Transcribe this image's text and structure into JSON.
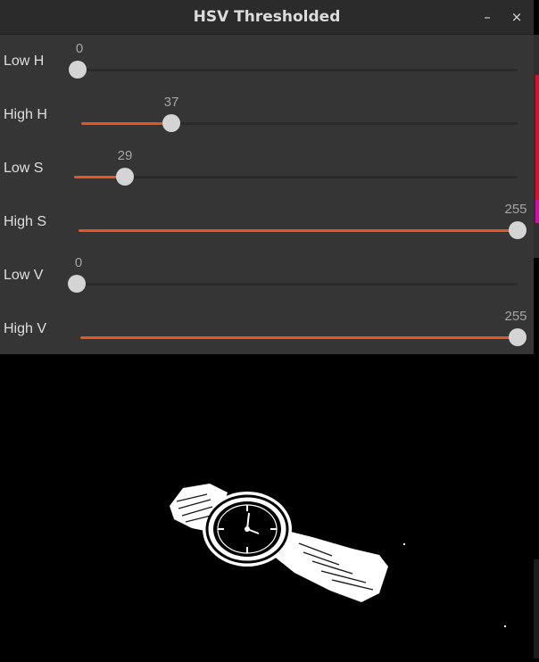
{
  "window": {
    "title": "HSV Thresholded",
    "minimize_glyph": "–",
    "close_glyph": "×"
  },
  "sliders": [
    {
      "label": "Low H",
      "value": "0",
      "fraction": 0.0
    },
    {
      "label": "High H",
      "value": "37",
      "fraction": 0.2
    },
    {
      "label": "Low S",
      "value": "29",
      "fraction": 0.114
    },
    {
      "label": "High S",
      "value": "255",
      "fraction": 1.0
    },
    {
      "label": "Low V",
      "value": "0",
      "fraction": 0.0
    },
    {
      "label": "High V",
      "value": "255",
      "fraction": 1.0
    }
  ],
  "colors": {
    "accent": "#e95420",
    "panel": "#353535",
    "knob": "#d4d4d4"
  },
  "image": {
    "description_icon": "thresholded-watch-image"
  }
}
